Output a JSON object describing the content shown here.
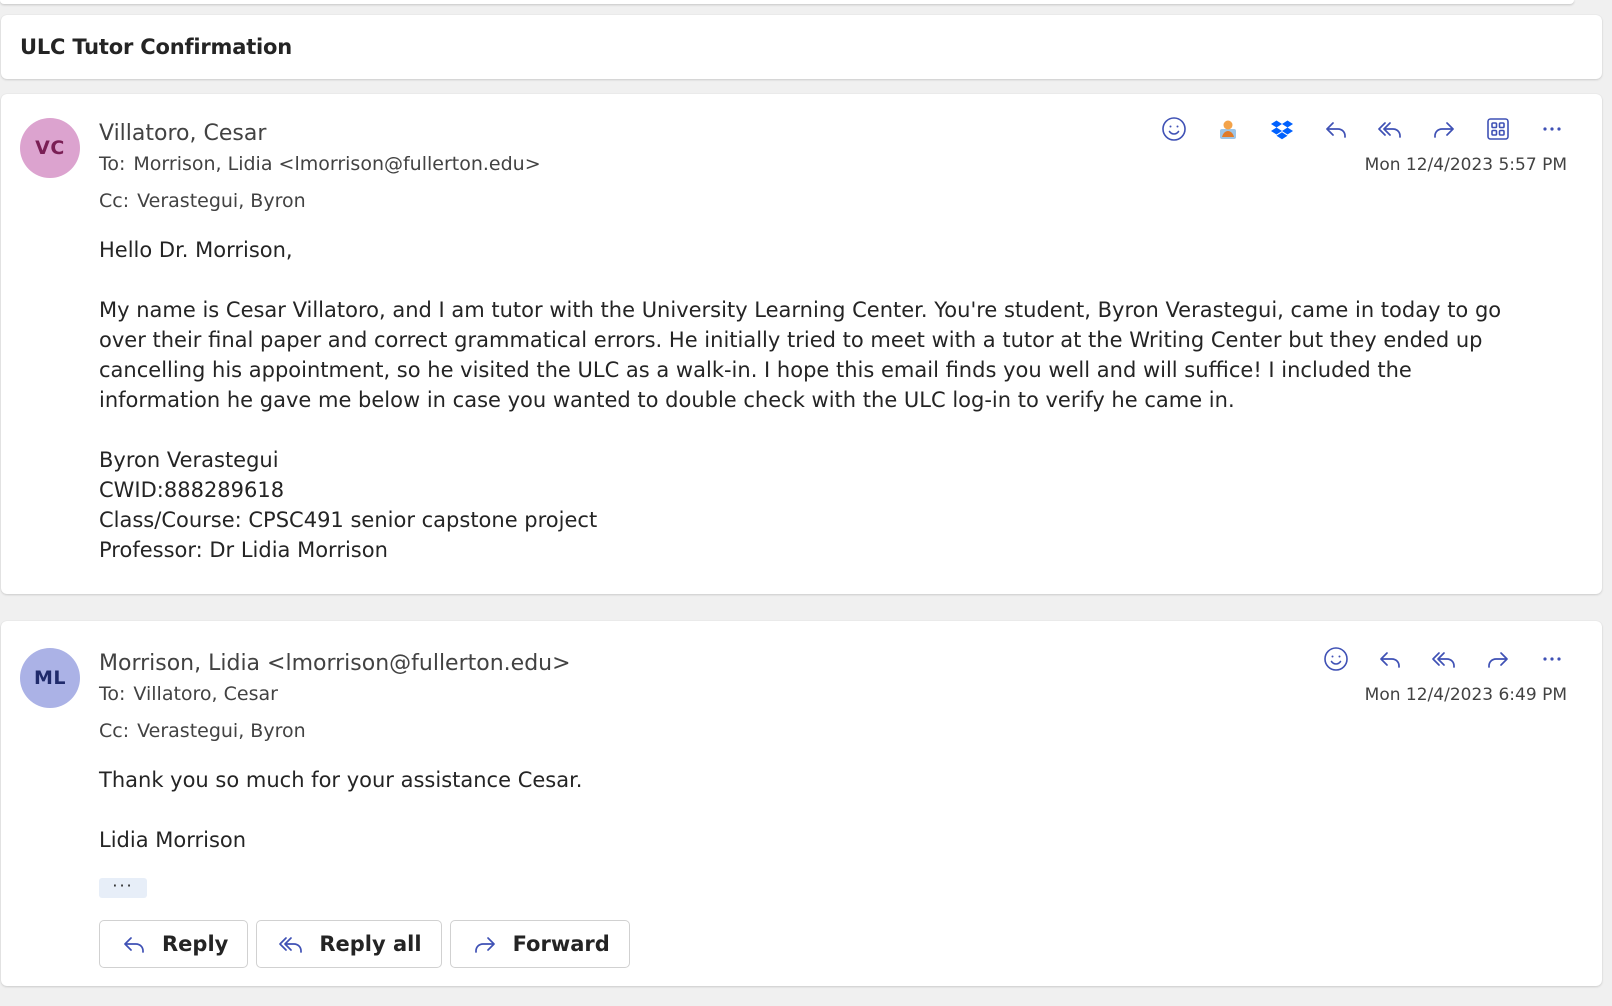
{
  "subject": "ULC Tutor Confirmation",
  "messages": [
    {
      "initials": "VC",
      "avatar_bg": "#dca3cf",
      "avatar_fg": "#7a1f55",
      "sender": "Villatoro, Cesar",
      "to_label": "To:",
      "to": "Morrison, Lidia <lmorrison@fullerton.edu>",
      "cc_label": "Cc:",
      "cc": "Verastegui, Byron",
      "datetime": "Mon 12/4/2023 5:57 PM",
      "body": {
        "greeting": "Hello Dr. Morrison,",
        "paragraph": "My name is Cesar Villatoro, and I am tutor with the University Learning Center. You're student, Byron Verastegui, came in today to go over their final paper and correct grammatical errors. He initially tried to meet with a tutor at the Writing Center but they ended up cancelling his appointment, so he visited the ULC as a walk-in. I hope this email finds you well and will suffice! I included the information he gave me below in case you wanted to double check with the ULC log-in to verify he came in.",
        "info": [
          "Byron Verastegui",
          "CWID:888289618",
          "Class/Course: CPSC491 senior capstone project",
          "Professor: Dr Lidia Morrison"
        ]
      }
    },
    {
      "initials": "ML",
      "avatar_bg": "#abb2e6",
      "avatar_fg": "#1f2a6b",
      "sender": "Morrison, Lidia <lmorrison@fullerton.edu>",
      "to_label": "To:",
      "to": "Villatoro, Cesar",
      "cc_label": "Cc:",
      "cc": "Verastegui, Byron",
      "datetime": "Mon 12/4/2023 6:49 PM",
      "body": {
        "line1": "Thank you so much for your assistance Cesar.",
        "signature": "Lidia Morrison"
      },
      "ellipsis": "···"
    }
  ],
  "footer": {
    "reply": "Reply",
    "reply_all": "Reply all",
    "forward": "Forward"
  },
  "icons": {
    "accent": "#3f51b5",
    "dropbox": "#0061fe"
  }
}
